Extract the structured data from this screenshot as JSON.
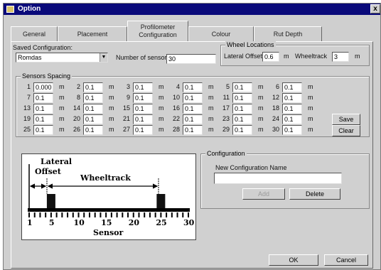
{
  "window": {
    "title": "Option",
    "close_glyph": "x"
  },
  "tabs": [
    {
      "label": "General"
    },
    {
      "label": "Placement"
    },
    {
      "label": "Profilometer Configuration"
    },
    {
      "label": "Colour"
    },
    {
      "label": "Rut Depth"
    }
  ],
  "saved_configuration": {
    "label": "Saved Configuration:",
    "value": "Romdas"
  },
  "number_of_sensors": {
    "label": "Number of sensors",
    "value": "30"
  },
  "wheel_locations": {
    "title": "Wheel Locations",
    "lateral_offset_label": "Lateral Offset",
    "lateral_offset_value": "0.6",
    "lateral_offset_unit": "m",
    "wheeltrack_label": "Wheeltrack",
    "wheeltrack_value": "3",
    "wheeltrack_unit": "m"
  },
  "sensor_spacing": {
    "title": "Sensors Spacing",
    "unit": "m",
    "sensors": [
      {
        "n": "1",
        "v": "0.000"
      },
      {
        "n": "2",
        "v": "0.1"
      },
      {
        "n": "3",
        "v": "0.1"
      },
      {
        "n": "4",
        "v": "0.1"
      },
      {
        "n": "5",
        "v": "0.1"
      },
      {
        "n": "6",
        "v": "0.1"
      },
      {
        "n": "7",
        "v": "0.1"
      },
      {
        "n": "8",
        "v": "0.1"
      },
      {
        "n": "9",
        "v": "0.1"
      },
      {
        "n": "10",
        "v": "0.1"
      },
      {
        "n": "11",
        "v": "0.1"
      },
      {
        "n": "12",
        "v": "0.1"
      },
      {
        "n": "13",
        "v": "0.1"
      },
      {
        "n": "14",
        "v": "0.1"
      },
      {
        "n": "15",
        "v": "0.1"
      },
      {
        "n": "16",
        "v": "0.1"
      },
      {
        "n": "17",
        "v": "0.1"
      },
      {
        "n": "18",
        "v": "0.1"
      },
      {
        "n": "19",
        "v": "0.1"
      },
      {
        "n": "20",
        "v": "0.1"
      },
      {
        "n": "21",
        "v": "0.1"
      },
      {
        "n": "22",
        "v": "0.1"
      },
      {
        "n": "23",
        "v": "0.1"
      },
      {
        "n": "24",
        "v": "0.1"
      },
      {
        "n": "25",
        "v": "0.1"
      },
      {
        "n": "26",
        "v": "0.1"
      },
      {
        "n": "27",
        "v": "0.1"
      },
      {
        "n": "28",
        "v": "0.1"
      },
      {
        "n": "29",
        "v": "0.1"
      },
      {
        "n": "30",
        "v": "0.1"
      }
    ],
    "save_label": "Save",
    "clear_label": "Clear"
  },
  "diagram": {
    "lateral_label": "Lateral",
    "offset_label": "Offset",
    "wheeltrack_label": "Wheeltrack",
    "sensor_label": "Sensor",
    "ticks": [
      "1",
      "5",
      "10",
      "15",
      "20",
      "25",
      "30"
    ],
    "wheel_positions": [
      5,
      25
    ]
  },
  "configuration": {
    "title": "Configuration",
    "new_name_label": "New Configuration Name",
    "new_name_value": "",
    "add_label": "Add",
    "delete_label": "Delete"
  },
  "footer": {
    "ok_label": "OK",
    "cancel_label": "Cancel"
  }
}
